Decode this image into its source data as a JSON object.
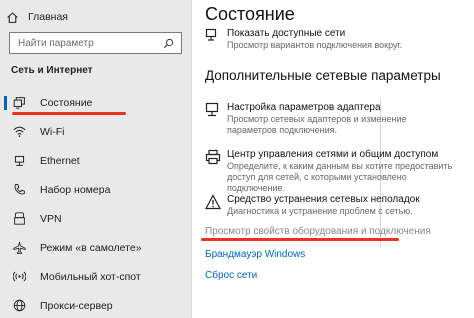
{
  "sidebar": {
    "home_label": "Главная",
    "search_placeholder": "Найти параметр",
    "section_title": "Сеть и Интернет",
    "items": [
      {
        "label": "Состояние",
        "icon": "status-monitor-icon",
        "active": true
      },
      {
        "label": "Wi-Fi",
        "icon": "wifi-icon"
      },
      {
        "label": "Ethernet",
        "icon": "ethernet-icon"
      },
      {
        "label": "Набор номера",
        "icon": "phone-icon"
      },
      {
        "label": "VPN",
        "icon": "vpn-icon"
      },
      {
        "label": "Режим «в самолете»",
        "icon": "airplane-icon"
      },
      {
        "label": "Мобильный хот-спот",
        "icon": "hotspot-icon"
      },
      {
        "label": "Прокси-сервер",
        "icon": "globe-icon"
      }
    ]
  },
  "main": {
    "title": "Состояние",
    "show_networks": {
      "title": "Показать доступные сети",
      "desc": "Просмотр вариантов подключения вокруг."
    },
    "advanced_title": "Дополнительные сетевые параметры",
    "adapter": {
      "title": "Настройка параметров адаптера",
      "desc": "Просмотр сетевых адаптеров и изменение параметров подключения."
    },
    "center": {
      "title": "Центр управления сетями и общим доступом",
      "desc": "Определите, к каким данным вы хотите предоставить доступ для сетей, с которыми установлено подключение."
    },
    "troubleshoot": {
      "title": "Средство устранения сетевых неполадок",
      "desc": "Диагностика и устранение проблем с сетью."
    },
    "view_hardware_link": "Просмотр свойств оборудования и подключения",
    "firewall_link": "Брандмауэр Windows",
    "reset_link": "Сброс сети"
  },
  "colors": {
    "accent": "#0063b1",
    "link": "#0067b8",
    "highlight_underline": "#e8341c",
    "sidebar_bg": "#e9e9e9"
  }
}
